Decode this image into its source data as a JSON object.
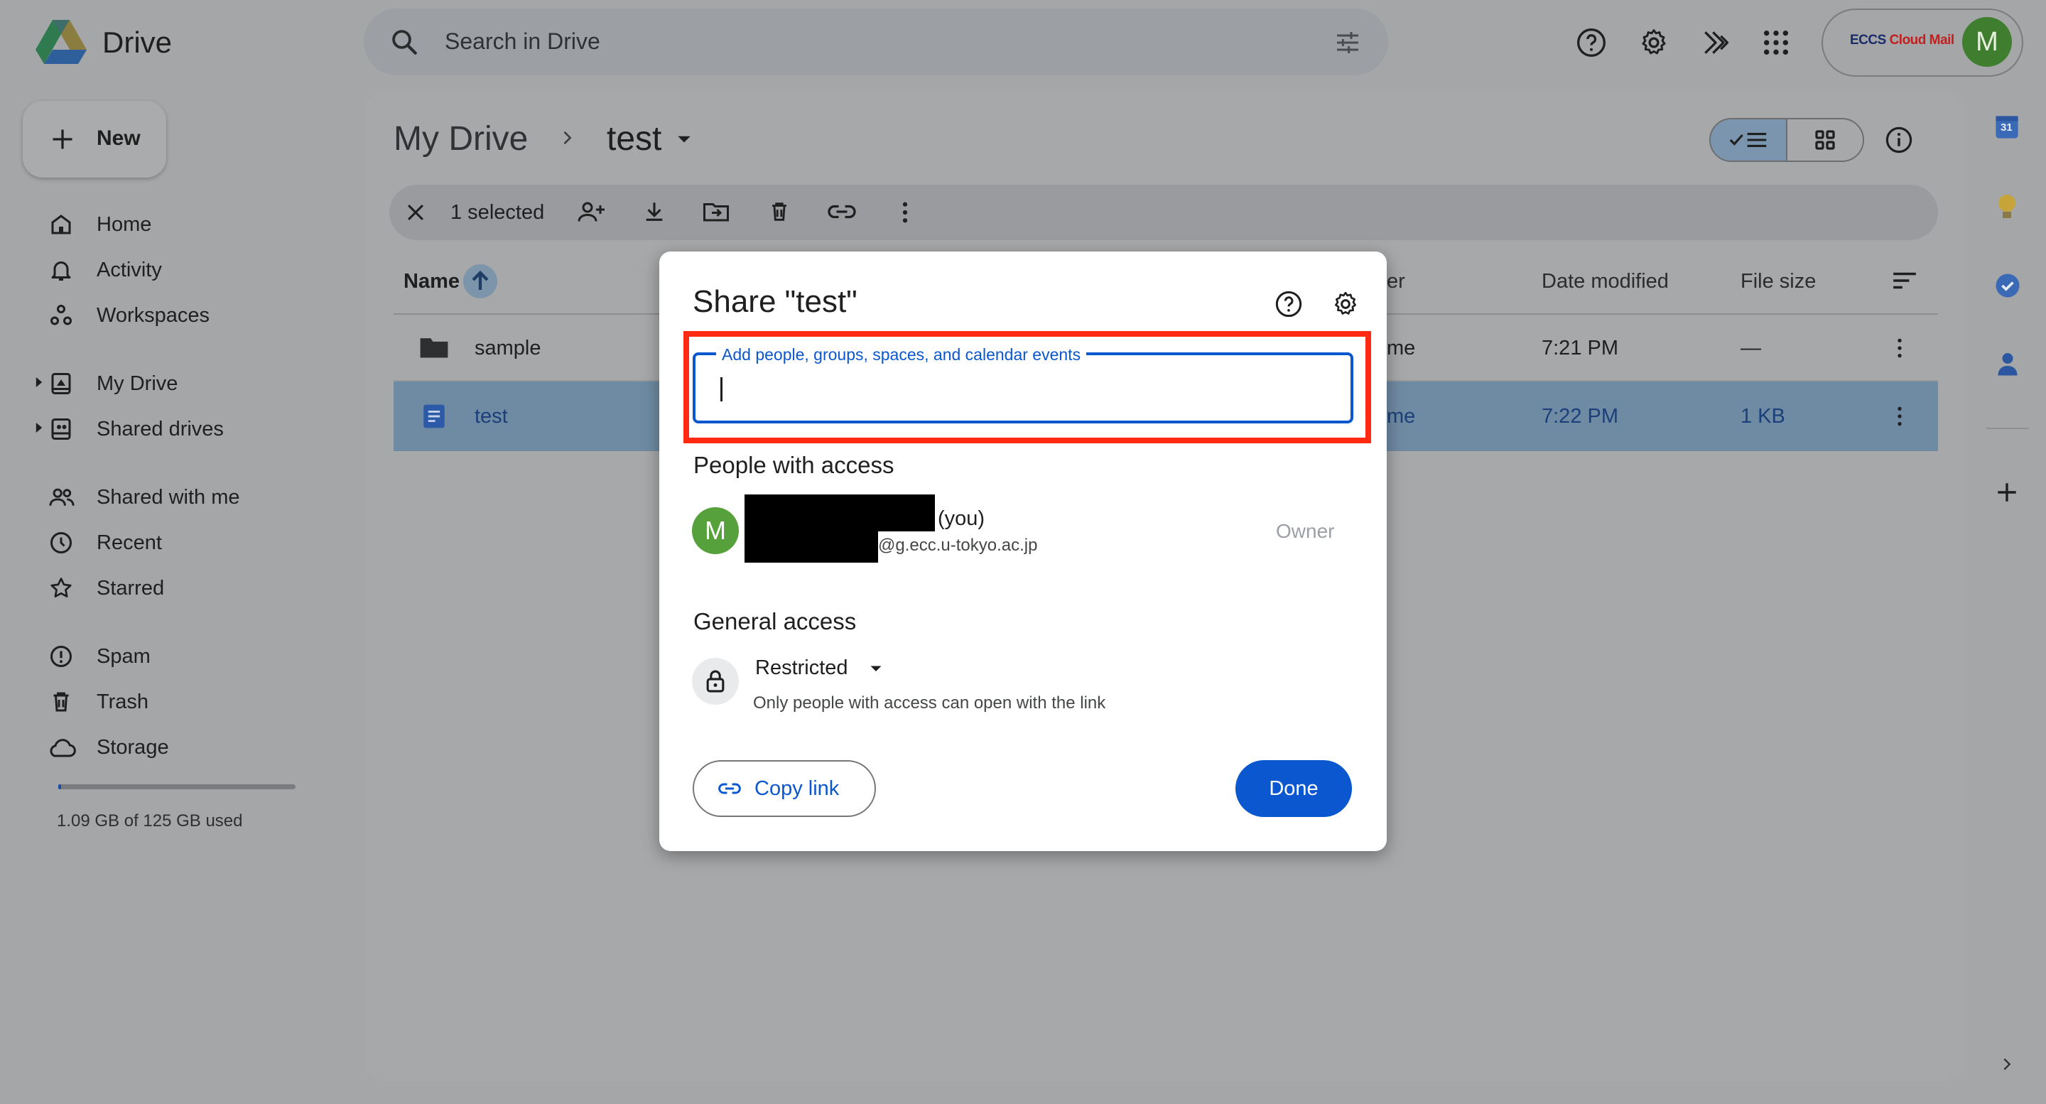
{
  "app": {
    "name": "Drive"
  },
  "header": {
    "search_placeholder": "Search in Drive",
    "account_badge_prefix": "ECCS ",
    "account_badge_suffix": "Cloud Mail",
    "avatar_initial": "M"
  },
  "sidebar": {
    "new_label": "New",
    "items": [
      {
        "label": "Home",
        "icon": "home-icon"
      },
      {
        "label": "Activity",
        "icon": "bell-icon"
      },
      {
        "label": "Workspaces",
        "icon": "workspaces-icon"
      },
      {
        "label": "My Drive",
        "icon": "my-drive-icon"
      },
      {
        "label": "Shared drives",
        "icon": "shared-drives-icon"
      },
      {
        "label": "Shared with me",
        "icon": "people-icon"
      },
      {
        "label": "Recent",
        "icon": "clock-icon"
      },
      {
        "label": "Starred",
        "icon": "star-icon"
      },
      {
        "label": "Spam",
        "icon": "spam-icon"
      },
      {
        "label": "Trash",
        "icon": "trash-icon"
      },
      {
        "label": "Storage",
        "icon": "cloud-icon"
      }
    ],
    "storage_text": "1.09 GB of 125 GB used",
    "storage_used_fraction": 0.0087
  },
  "breadcrumb": {
    "root": "My Drive",
    "current": "test"
  },
  "selection_bar": {
    "count_label": "1 selected"
  },
  "table": {
    "columns": {
      "name": "Name",
      "owner_partial": "er",
      "date_modified": "Date modified",
      "file_size": "File size"
    },
    "rows": [
      {
        "name": "sample",
        "owner_partial": "me",
        "date": "7:21 PM",
        "size": "—",
        "type": "folder"
      },
      {
        "name": "test",
        "owner_partial": "me",
        "date": "7:22 PM",
        "size": "1 KB",
        "type": "doc",
        "selected": true
      }
    ]
  },
  "right_panel": {
    "calendar_day": "31"
  },
  "dialog": {
    "title": "Share \"test\"",
    "input_label": "Add people, groups, spaces, and calendar events",
    "input_value": "",
    "people_heading": "People with access",
    "person": {
      "initial": "M",
      "you_suffix": "(you)",
      "email": "@g.ecc.u-tokyo.ac.jp",
      "role": "Owner"
    },
    "general_heading": "General access",
    "access_level": "Restricted",
    "access_desc": "Only people with access can open with the link",
    "copy_link_label": "Copy link",
    "done_label": "Done"
  },
  "colors": {
    "accent": "#0b57d0",
    "highlight": "#ff2a12",
    "avatar": "#57a13c"
  }
}
